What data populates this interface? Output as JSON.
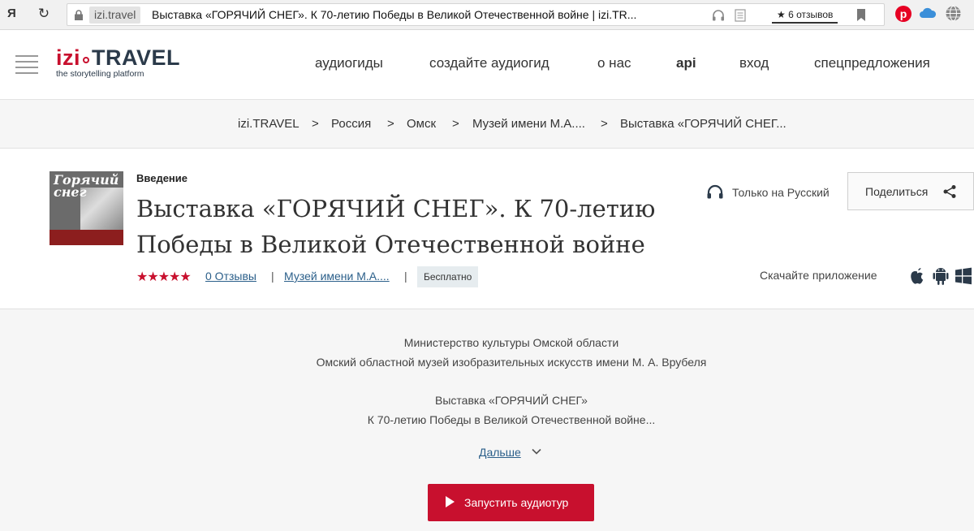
{
  "browser": {
    "logo": "Я",
    "domain": "izi.travel",
    "tab_title": "Выставка «ГОРЯЧИЙ СНЕГ». К 70-летию Победы в Великой Отечественной войне | izi.TR...",
    "reviews_chip": "★ 6 отзывов"
  },
  "header": {
    "logo_izi": "izi",
    "logo_travel": "TRAVEL",
    "logo_tagline": "the storytelling platform",
    "nav": [
      "аудиогиды",
      "создайте аудиогид",
      "о нас",
      "api",
      "вход",
      "спецпредложения"
    ]
  },
  "breadcrumb": [
    "izi.TRAVEL",
    "Россия",
    "Омск",
    "Музей имени М.А....",
    "Выставка «ГОРЯЧИЙ СНЕГ..."
  ],
  "breadcrumb_sep": ">",
  "tour": {
    "cover_title_1": "Горячий",
    "cover_title_2": "снег",
    "section": "Введение",
    "title": "Выставка «ГОРЯЧИЙ СНЕГ». К 70-летию Победы в Великой Отечественной войне",
    "stars": "★★★★★",
    "rating_value": 5,
    "reviews": "0 Отзывы",
    "meta_sep": "|",
    "museum": "Музей имени М.А....",
    "price": "Бесплатно",
    "language": "Только на Русский",
    "share": "Поделиться",
    "download_app": "Скачайте приложение"
  },
  "description": {
    "lines": [
      "Министерство культуры Омской области",
      "Омский областной музей изобразительных искусств имени М. А. Врубеля",
      "Выставка «ГОРЯЧИЙ СНЕГ»",
      "К 70-летию Победы в Великой Отечественной войне..."
    ],
    "more": "Дальше",
    "play": "Запустить аудиотур"
  },
  "colors": {
    "accent": "#c8102e",
    "link": "#2b5f8a",
    "logo_dark": "#2b3a4a"
  },
  "icons": [
    "reload-icon",
    "lock-icon",
    "headphones-icon",
    "reader-icon",
    "bookmark-icon",
    "pinterest-icon",
    "cloud-icon",
    "globe-icon",
    "hamburger-icon",
    "share-icon",
    "apple-icon",
    "android-icon",
    "windows-icon",
    "chevron-down-icon",
    "play-icon"
  ]
}
